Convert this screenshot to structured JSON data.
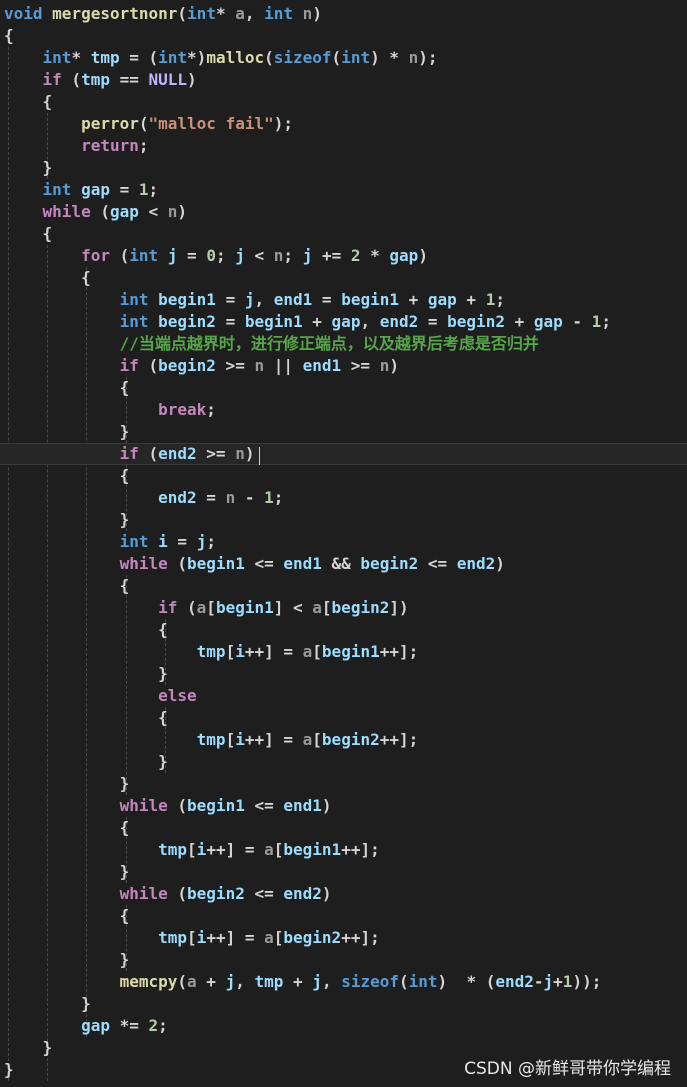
{
  "editor": {
    "lines": [
      [
        [
          "kw",
          "void"
        ],
        [
          "p",
          " "
        ],
        [
          "fn",
          "mergesortnonr"
        ],
        [
          "p",
          "("
        ],
        [
          "kw",
          "int"
        ],
        [
          "p",
          "* "
        ],
        [
          "param",
          "a"
        ],
        [
          "p",
          ", "
        ],
        [
          "kw",
          "int"
        ],
        [
          "p",
          " "
        ],
        [
          "param",
          "n"
        ],
        [
          "p",
          ")"
        ]
      ],
      [
        [
          "p",
          "{"
        ]
      ],
      [
        [
          "p",
          "    "
        ],
        [
          "kw",
          "int"
        ],
        [
          "p",
          "* "
        ],
        [
          "var",
          "tmp"
        ],
        [
          "p",
          " = ("
        ],
        [
          "kw",
          "int"
        ],
        [
          "p",
          "*)"
        ],
        [
          "fn",
          "malloc"
        ],
        [
          "p",
          "("
        ],
        [
          "kw",
          "sizeof"
        ],
        [
          "p",
          "("
        ],
        [
          "kw",
          "int"
        ],
        [
          "p",
          ") * "
        ],
        [
          "param",
          "n"
        ],
        [
          "p",
          ");"
        ]
      ],
      [
        [
          "p",
          "    "
        ],
        [
          "ctl",
          "if"
        ],
        [
          "p",
          " ("
        ],
        [
          "var",
          "tmp"
        ],
        [
          "p",
          " == "
        ],
        [
          "macro",
          "NULL"
        ],
        [
          "p",
          ")"
        ]
      ],
      [
        [
          "p",
          "    {"
        ]
      ],
      [
        [
          "p",
          "        "
        ],
        [
          "fn",
          "perror"
        ],
        [
          "p",
          "("
        ],
        [
          "str",
          "\"malloc fail\""
        ],
        [
          "p",
          ");"
        ]
      ],
      [
        [
          "p",
          "        "
        ],
        [
          "ctl",
          "return"
        ],
        [
          "p",
          ";"
        ]
      ],
      [
        [
          "p",
          "    }"
        ]
      ],
      [
        [
          "p",
          "    "
        ],
        [
          "kw",
          "int"
        ],
        [
          "p",
          " "
        ],
        [
          "var",
          "gap"
        ],
        [
          "p",
          " = "
        ],
        [
          "num",
          "1"
        ],
        [
          "p",
          ";"
        ]
      ],
      [
        [
          "p",
          "    "
        ],
        [
          "ctl",
          "while"
        ],
        [
          "p",
          " ("
        ],
        [
          "var",
          "gap"
        ],
        [
          "p",
          " < "
        ],
        [
          "param",
          "n"
        ],
        [
          "p",
          ")"
        ]
      ],
      [
        [
          "p",
          "    {"
        ]
      ],
      [
        [
          "p",
          "        "
        ],
        [
          "ctl",
          "for"
        ],
        [
          "p",
          " ("
        ],
        [
          "kw",
          "int"
        ],
        [
          "p",
          " "
        ],
        [
          "var",
          "j"
        ],
        [
          "p",
          " = "
        ],
        [
          "num",
          "0"
        ],
        [
          "p",
          "; "
        ],
        [
          "var",
          "j"
        ],
        [
          "p",
          " < "
        ],
        [
          "param",
          "n"
        ],
        [
          "p",
          "; "
        ],
        [
          "var",
          "j"
        ],
        [
          "p",
          " += "
        ],
        [
          "num",
          "2"
        ],
        [
          "p",
          " * "
        ],
        [
          "var",
          "gap"
        ],
        [
          "p",
          ")"
        ]
      ],
      [
        [
          "p",
          "        {"
        ]
      ],
      [
        [
          "p",
          "            "
        ],
        [
          "kw",
          "int"
        ],
        [
          "p",
          " "
        ],
        [
          "var",
          "begin1"
        ],
        [
          "p",
          " = "
        ],
        [
          "var",
          "j"
        ],
        [
          "p",
          ", "
        ],
        [
          "var",
          "end1"
        ],
        [
          "p",
          " = "
        ],
        [
          "var",
          "begin1"
        ],
        [
          "p",
          " + "
        ],
        [
          "var",
          "gap"
        ],
        [
          "p",
          " + "
        ],
        [
          "num",
          "1"
        ],
        [
          "p",
          ";"
        ]
      ],
      [
        [
          "p",
          "            "
        ],
        [
          "kw",
          "int"
        ],
        [
          "p",
          " "
        ],
        [
          "var",
          "begin2"
        ],
        [
          "p",
          " = "
        ],
        [
          "var",
          "begin1"
        ],
        [
          "p",
          " + "
        ],
        [
          "var",
          "gap"
        ],
        [
          "p",
          ", "
        ],
        [
          "var",
          "end2"
        ],
        [
          "p",
          " = "
        ],
        [
          "var",
          "begin2"
        ],
        [
          "p",
          " + "
        ],
        [
          "var",
          "gap"
        ],
        [
          "p",
          " - "
        ],
        [
          "num",
          "1"
        ],
        [
          "p",
          ";"
        ]
      ],
      [
        [
          "p",
          "            "
        ],
        [
          "comment",
          "//当端点越界时，进行修正端点，以及越界后考虑是否归并"
        ]
      ],
      [
        [
          "p",
          "            "
        ],
        [
          "ctl",
          "if"
        ],
        [
          "p",
          " ("
        ],
        [
          "var",
          "begin2"
        ],
        [
          "p",
          " >= "
        ],
        [
          "param",
          "n"
        ],
        [
          "p",
          " || "
        ],
        [
          "var",
          "end1"
        ],
        [
          "p",
          " >= "
        ],
        [
          "param",
          "n"
        ],
        [
          "p",
          ")"
        ]
      ],
      [
        [
          "p",
          "            {"
        ]
      ],
      [
        [
          "p",
          "                "
        ],
        [
          "ctl",
          "break"
        ],
        [
          "p",
          ";"
        ]
      ],
      [
        [
          "p",
          "            }"
        ]
      ],
      [
        [
          "p",
          "            "
        ],
        [
          "ctl",
          "if"
        ],
        [
          "p",
          " ("
        ],
        [
          "var",
          "end2"
        ],
        [
          "p",
          " >= "
        ],
        [
          "param",
          "n"
        ],
        [
          "p",
          ")"
        ]
      ],
      [
        [
          "p",
          "            {"
        ]
      ],
      [
        [
          "p",
          "                "
        ],
        [
          "var",
          "end2"
        ],
        [
          "p",
          " = "
        ],
        [
          "param",
          "n"
        ],
        [
          "p",
          " - "
        ],
        [
          "num",
          "1"
        ],
        [
          "p",
          ";"
        ]
      ],
      [
        [
          "p",
          "            }"
        ]
      ],
      [
        [
          "p",
          "            "
        ],
        [
          "kw",
          "int"
        ],
        [
          "p",
          " "
        ],
        [
          "var",
          "i"
        ],
        [
          "p",
          " = "
        ],
        [
          "var",
          "j"
        ],
        [
          "p",
          ";"
        ]
      ],
      [
        [
          "p",
          "            "
        ],
        [
          "ctl",
          "while"
        ],
        [
          "p",
          " ("
        ],
        [
          "var",
          "begin1"
        ],
        [
          "p",
          " <= "
        ],
        [
          "var",
          "end1"
        ],
        [
          "p",
          " && "
        ],
        [
          "var",
          "begin2"
        ],
        [
          "p",
          " <= "
        ],
        [
          "var",
          "end2"
        ],
        [
          "p",
          ")"
        ]
      ],
      [
        [
          "p",
          "            {"
        ]
      ],
      [
        [
          "p",
          "                "
        ],
        [
          "ctl",
          "if"
        ],
        [
          "p",
          " ("
        ],
        [
          "param",
          "a"
        ],
        [
          "p",
          "["
        ],
        [
          "var",
          "begin1"
        ],
        [
          "p",
          "] < "
        ],
        [
          "param",
          "a"
        ],
        [
          "p",
          "["
        ],
        [
          "var",
          "begin2"
        ],
        [
          "p",
          "])"
        ]
      ],
      [
        [
          "p",
          "                {"
        ]
      ],
      [
        [
          "p",
          "                    "
        ],
        [
          "var",
          "tmp"
        ],
        [
          "p",
          "["
        ],
        [
          "var",
          "i"
        ],
        [
          "p",
          "++] = "
        ],
        [
          "param",
          "a"
        ],
        [
          "p",
          "["
        ],
        [
          "var",
          "begin1"
        ],
        [
          "p",
          "++];"
        ]
      ],
      [
        [
          "p",
          "                }"
        ]
      ],
      [
        [
          "p",
          "                "
        ],
        [
          "ctl",
          "else"
        ]
      ],
      [
        [
          "p",
          "                {"
        ]
      ],
      [
        [
          "p",
          "                    "
        ],
        [
          "var",
          "tmp"
        ],
        [
          "p",
          "["
        ],
        [
          "var",
          "i"
        ],
        [
          "p",
          "++] = "
        ],
        [
          "param",
          "a"
        ],
        [
          "p",
          "["
        ],
        [
          "var",
          "begin2"
        ],
        [
          "p",
          "++];"
        ]
      ],
      [
        [
          "p",
          "                }"
        ]
      ],
      [
        [
          "p",
          "            }"
        ]
      ],
      [
        [
          "p",
          "            "
        ],
        [
          "ctl",
          "while"
        ],
        [
          "p",
          " ("
        ],
        [
          "var",
          "begin1"
        ],
        [
          "p",
          " <= "
        ],
        [
          "var",
          "end1"
        ],
        [
          "p",
          ")"
        ]
      ],
      [
        [
          "p",
          "            {"
        ]
      ],
      [
        [
          "p",
          "                "
        ],
        [
          "var",
          "tmp"
        ],
        [
          "p",
          "["
        ],
        [
          "var",
          "i"
        ],
        [
          "p",
          "++] = "
        ],
        [
          "param",
          "a"
        ],
        [
          "p",
          "["
        ],
        [
          "var",
          "begin1"
        ],
        [
          "p",
          "++];"
        ]
      ],
      [
        [
          "p",
          "            }"
        ]
      ],
      [
        [
          "p",
          "            "
        ],
        [
          "ctl",
          "while"
        ],
        [
          "p",
          " ("
        ],
        [
          "var",
          "begin2"
        ],
        [
          "p",
          " <= "
        ],
        [
          "var",
          "end2"
        ],
        [
          "p",
          ")"
        ]
      ],
      [
        [
          "p",
          "            {"
        ]
      ],
      [
        [
          "p",
          "                "
        ],
        [
          "var",
          "tmp"
        ],
        [
          "p",
          "["
        ],
        [
          "var",
          "i"
        ],
        [
          "p",
          "++] = "
        ],
        [
          "param",
          "a"
        ],
        [
          "p",
          "["
        ],
        [
          "var",
          "begin2"
        ],
        [
          "p",
          "++];"
        ]
      ],
      [
        [
          "p",
          "            }"
        ]
      ],
      [
        [
          "p",
          "            "
        ],
        [
          "fn",
          "memcpy"
        ],
        [
          "p",
          "("
        ],
        [
          "param",
          "a"
        ],
        [
          "p",
          " + "
        ],
        [
          "var",
          "j"
        ],
        [
          "p",
          ", "
        ],
        [
          "var",
          "tmp"
        ],
        [
          "p",
          " + "
        ],
        [
          "var",
          "j"
        ],
        [
          "p",
          ", "
        ],
        [
          "kw",
          "sizeof"
        ],
        [
          "p",
          "("
        ],
        [
          "kw",
          "int"
        ],
        [
          "p",
          ")  * ("
        ],
        [
          "var",
          "end2"
        ],
        [
          "p",
          "-"
        ],
        [
          "var",
          "j"
        ],
        [
          "p",
          "+"
        ],
        [
          "num",
          "1"
        ],
        [
          "p",
          "));"
        ]
      ],
      [
        [
          "p",
          "        }"
        ]
      ],
      [
        [
          "p",
          "        "
        ],
        [
          "var",
          "gap"
        ],
        [
          "p",
          " *= "
        ],
        [
          "num",
          "2"
        ],
        [
          "p",
          ";"
        ]
      ],
      [
        [
          "p",
          "    }"
        ]
      ],
      [
        [
          "p",
          "}"
        ]
      ]
    ]
  },
  "watermark": {
    "text": "CSDN @新鲜哥带你学编程"
  }
}
